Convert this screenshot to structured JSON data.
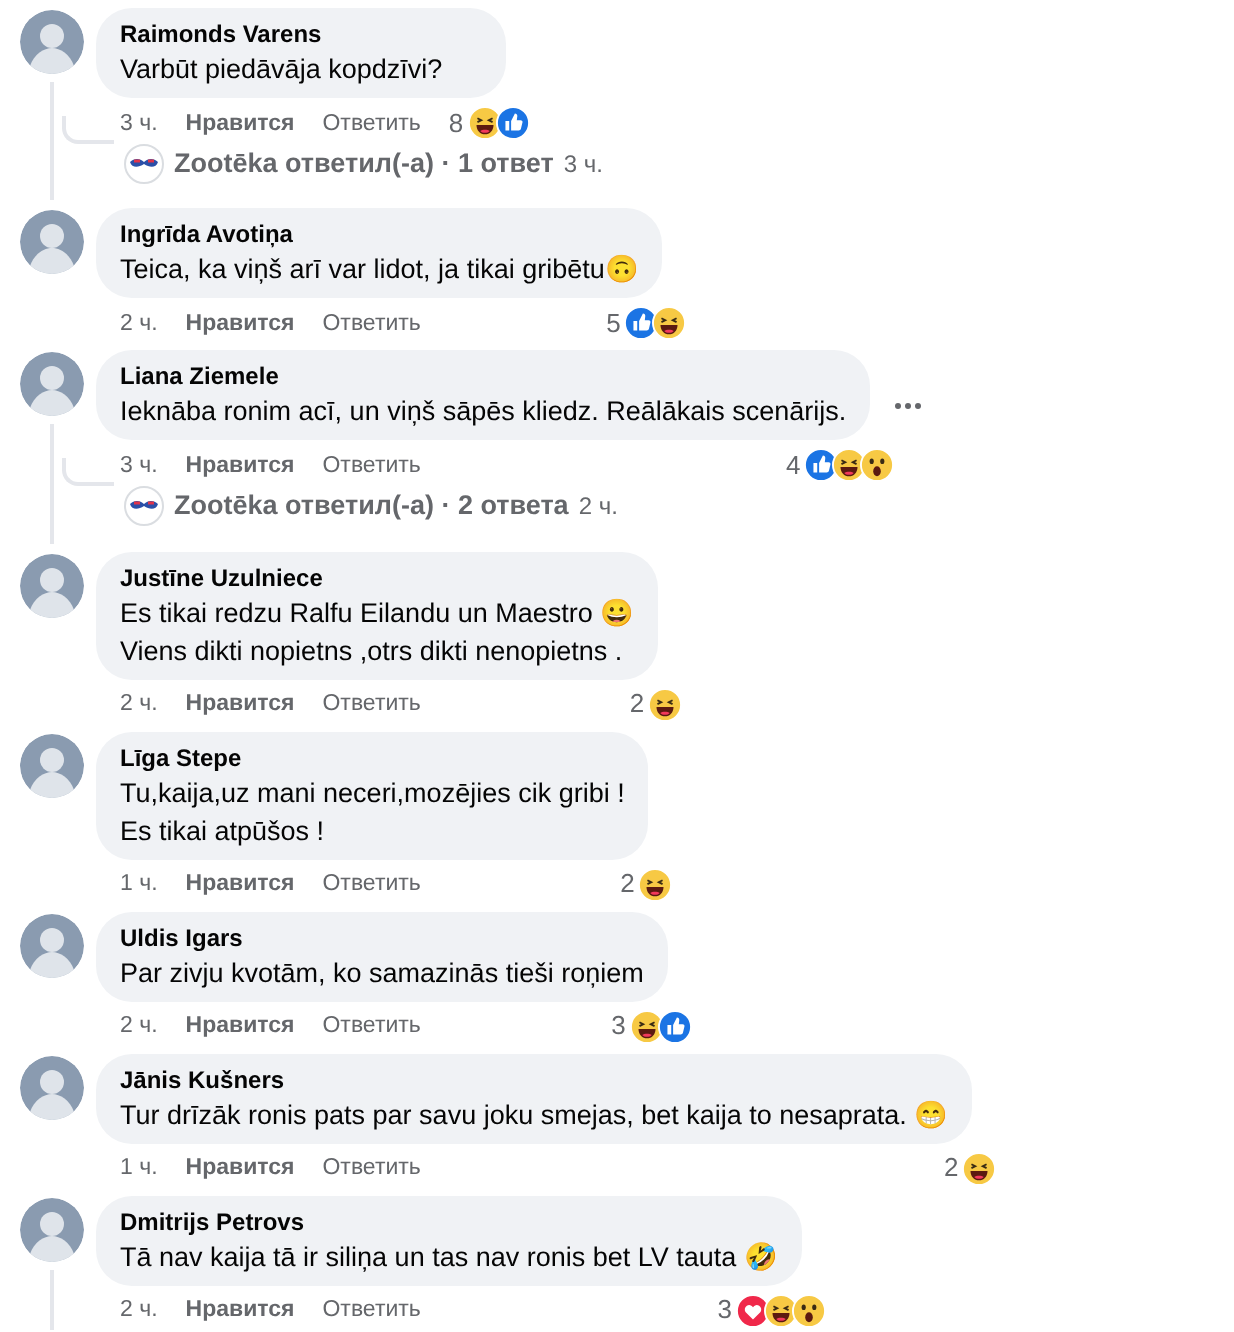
{
  "comments": [
    {
      "author": "Raimonds Varens",
      "text": "Varbūt piedāvāja kopdzīvi?",
      "time": "3 ч.",
      "like": "Нравится",
      "reply": "Ответить",
      "reaction_count": "8",
      "reactions": [
        {
          "kind": "haha"
        },
        {
          "kind": "like"
        }
      ],
      "hovered": false,
      "has_replies": true,
      "replies_link": {
        "text": "Zootēka ответил(-а) · 1 ответ",
        "time": "3 ч."
      }
    },
    {
      "author": "Ingrīda Avotiņa",
      "text": "Teica, ka viņš arī var lidot, ja tikai gribētu🙃",
      "time": "2 ч.",
      "like": "Нравится",
      "reply": "Ответить",
      "reaction_count": "5",
      "reactions": [
        {
          "kind": "like"
        },
        {
          "kind": "haha"
        }
      ],
      "hovered": false,
      "has_replies": false
    },
    {
      "author": "Liana Ziemele",
      "text": "Ieknāba ronim acī, un viņš sāpēs kliedz. Reālākais scenārijs.",
      "time": "3 ч.",
      "like": "Нравится",
      "reply": "Ответить",
      "reaction_count": "4",
      "reactions": [
        {
          "kind": "like"
        },
        {
          "kind": "haha"
        },
        {
          "kind": "wow"
        }
      ],
      "hovered": true,
      "has_replies": true,
      "replies_link": {
        "text": "Zootēka ответил(-а) · 2 ответа",
        "time": "2 ч."
      }
    },
    {
      "author": "Justīne Uzulniece",
      "lines": [
        "Es tikai redzu Ralfu Eilandu un Maestro 😀",
        "Viens dikti nopietns ,otrs dikti nenopietns ."
      ],
      "time": "2 ч.",
      "like": "Нравится",
      "reply": "Ответить",
      "reaction_count": "2",
      "reactions": [
        {
          "kind": "haha"
        }
      ],
      "hovered": false,
      "has_replies": false
    },
    {
      "author": "Līga Stepe",
      "lines": [
        "Tu,kaija,uz mani neceri,mozējies cik gribi !",
        "Es tikai atpūšos !"
      ],
      "time": "1 ч.",
      "like": "Нравится",
      "reply": "Ответить",
      "reaction_count": "2",
      "reactions": [
        {
          "kind": "haha"
        }
      ],
      "hovered": false,
      "has_replies": false
    },
    {
      "author": "Uldis Igars",
      "text": "Par zivju kvotām, ko samazinās tieši roņiem",
      "time": "2 ч.",
      "like": "Нравится",
      "reply": "Ответить",
      "reaction_count": "3",
      "reactions": [
        {
          "kind": "haha"
        },
        {
          "kind": "like"
        }
      ],
      "hovered": false,
      "has_replies": false
    },
    {
      "author": "Jānis Kušners",
      "text": "Tur drīzāk ronis pats par savu joku smejas, bet kaija to nesaprata. 😁",
      "time": "1 ч.",
      "like": "Нравится",
      "reply": "Ответить",
      "reaction_count": "2",
      "reactions": [
        {
          "kind": "haha"
        }
      ],
      "hovered": false,
      "has_replies": false
    },
    {
      "author": "Dmitrijs Petrovs",
      "text": "Tā nav kaija tā ir siliņa un tas nav ronis bet LV tauta 🤣",
      "time": "2 ч.",
      "like": "Нравится",
      "reply": "Ответить",
      "reaction_count": "3",
      "reactions": [
        {
          "kind": "love"
        },
        {
          "kind": "haha"
        },
        {
          "kind": "wow"
        }
      ],
      "hovered": false,
      "has_replies": true
    }
  ]
}
